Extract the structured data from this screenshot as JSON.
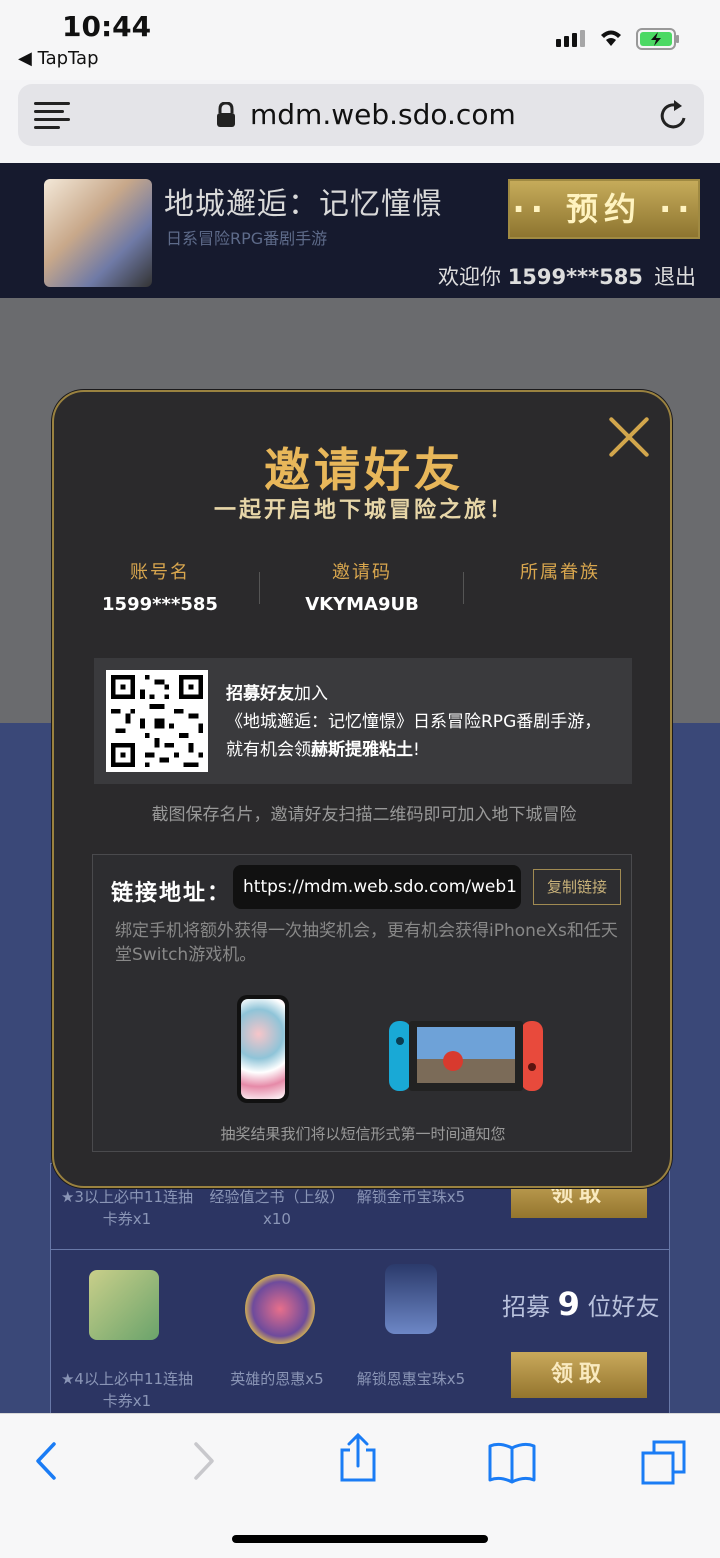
{
  "status_bar": {
    "time": "10:44",
    "back_app": "◀ TapTap"
  },
  "browser": {
    "url": "mdm.web.sdo.com"
  },
  "site_header": {
    "game_title": "地城邂逅：记忆憧憬",
    "game_subtitle": "日系冒险RPG番剧手游",
    "reserve_label": "·· 预约 ··",
    "welcome_label": "欢迎你",
    "username": "1599***585",
    "logout_label": "退出"
  },
  "modal": {
    "title": "邀请好友",
    "subtitle": "一起开启地下城冒险之旅！",
    "account_label": "账号名",
    "account_value": "1599***585",
    "invite_code_label": "邀请码",
    "invite_code_value": "VKYMA9UB",
    "family_label": "所属眷族",
    "family_value": "",
    "recruit_bold": "招募好友",
    "recruit_join": "加入",
    "recruit_line2": "《地城邂逅：记忆憧憬》日系冒险RPG番剧手游，",
    "recruit_line3_prefix": "就有机会领",
    "recruit_prize": "赫斯提雅粘土",
    "recruit_line3_suffix": "!",
    "save_tip": "截图保存名片，邀请好友扫描二维码即可加入地下城冒险",
    "link_label": "链接地址：",
    "link_value": "https://mdm.web.sdo.com/web1",
    "copy_label": "复制链接",
    "bind_tip": "绑定手机将额外获得一次抽奖机会，更有机会获得iPhoneXs和任天堂Switch游戏机。",
    "notice": "抽奖结果我们将以短信形式第一时间通知您"
  },
  "rewards": {
    "row1": {
      "item1": "★3以上必中11连抽卡券x1",
      "item2": "经验值之书（上级）x10",
      "item3": "解锁金币宝珠x5",
      "claim": "领取"
    },
    "row2": {
      "item1": "★4以上必中11连抽卡券x1",
      "item2": "英雄的恩惠x5",
      "item3": "解锁恩惠宝珠x5",
      "recruit_prefix": "招募",
      "recruit_count": "9",
      "recruit_suffix": "位好友",
      "claim": "领取"
    }
  },
  "colors": {
    "accent_gold": "#e8b75a",
    "modal_bg": "#2b2a2c",
    "ios_blue": "#1a7cf5"
  }
}
